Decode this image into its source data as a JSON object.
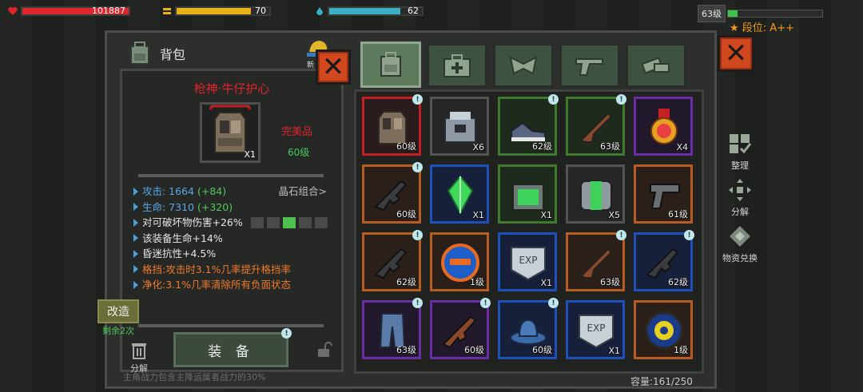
{
  "hud": {
    "hp_value": "101887",
    "energy_value": "70",
    "mana_value": "62",
    "level": "63级",
    "rank": "段位: A++",
    "hp_fraction": 1.0,
    "energy_fraction": 0.8,
    "mana_fraction": 0.77,
    "level_fraction": 0.1
  },
  "panel": {
    "title": "背包",
    "shop_hint": "新"
  },
  "item": {
    "name": "枪神·牛仔护心",
    "count": "X1",
    "quality": "完美品",
    "level": "60级"
  },
  "stats": {
    "attack_label": "攻击: 1664",
    "attack_bonus": "(+84)",
    "crystal_combo": "晶石组合>",
    "life_label": "生命: 7310",
    "life_bonus": "(+320)",
    "destructible": "对可破坏物伤害+26%",
    "equip_life": "该装备生命+14%",
    "stun_resist": "昏迷抗性+4.5%",
    "block": "格挡:攻击时3.1%几率提升格挡率",
    "purify": "净化:3.1%几率清除所有负面状态"
  },
  "actions": {
    "reform": "改造",
    "remaining": "剩余2次",
    "disassemble": "分解",
    "equip": "装 备",
    "footer_notice": "主角战力包含主降运属者战力的30%"
  },
  "side": {
    "sort": "整理",
    "split": "分解",
    "exchange": "物资兑换"
  },
  "capacity": "容量:161/250",
  "slots": [
    {
      "lv": "60级",
      "q": "red",
      "icon": "vest-icon",
      "bang": true
    },
    {
      "lv": "X6",
      "q": "grey",
      "icon": "supply-box-icon",
      "bang": false
    },
    {
      "lv": "62级",
      "q": "green",
      "icon": "sneakers-icon",
      "bang": true
    },
    {
      "lv": "63级",
      "q": "green",
      "icon": "rifle-icon",
      "bang": true
    },
    {
      "lv": "X4",
      "q": "purple",
      "icon": "medal-icon",
      "bang": false
    },
    {
      "lv": "60级",
      "q": "orange",
      "icon": "assault-rifle-icon",
      "bang": true
    },
    {
      "lv": "X1",
      "q": "blue",
      "icon": "gem-icon",
      "bang": false
    },
    {
      "lv": "X1",
      "q": "green",
      "icon": "green-chest-icon",
      "bang": false
    },
    {
      "lv": "X5",
      "q": "grey",
      "icon": "capsule-icon",
      "bang": false
    },
    {
      "lv": "61级",
      "q": "orange",
      "icon": "pistol-icon",
      "bang": false
    },
    {
      "lv": "62级",
      "q": "orange",
      "icon": "assault-rifle-icon",
      "bang": true
    },
    {
      "lv": "1级",
      "q": "orange",
      "icon": "gun-badge-icon",
      "bang": false
    },
    {
      "lv": "X1",
      "q": "blue",
      "icon": "exp-card-icon",
      "bang": false
    },
    {
      "lv": "63级",
      "q": "orange",
      "icon": "rifle-icon",
      "bang": true
    },
    {
      "lv": "62级",
      "q": "blue",
      "icon": "assault-rifle-icon",
      "bang": true
    },
    {
      "lv": "63级",
      "q": "purple",
      "icon": "jeans-icon",
      "bang": true
    },
    {
      "lv": "60级",
      "q": "purple",
      "icon": "ak-rifle-icon",
      "bang": true
    },
    {
      "lv": "60级",
      "q": "blue",
      "icon": "cowboy-hat-icon",
      "bang": true
    },
    {
      "lv": "X1",
      "q": "blue",
      "icon": "exp-card-icon",
      "bang": false
    },
    {
      "lv": "1级",
      "q": "orange",
      "icon": "gear-badge-icon",
      "bang": false
    }
  ],
  "colors": {
    "hp": "#e0242c",
    "energy": "#e8b319",
    "mana": "#3ab0c4",
    "level": "#3ac24a",
    "close": "#d2481e",
    "tab_active": "#5d7a5d"
  }
}
